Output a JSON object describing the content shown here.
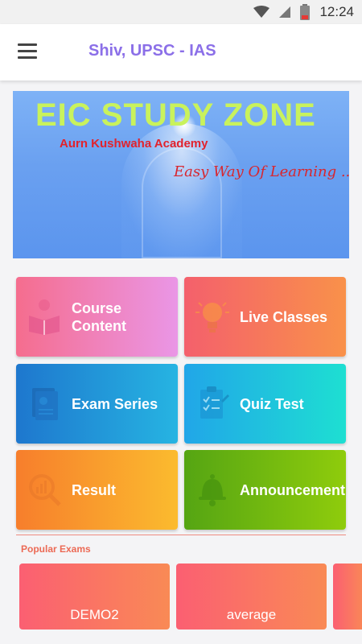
{
  "status_bar": {
    "time": "12:24"
  },
  "app_bar": {
    "title": "Shiv, UPSC - IAS",
    "title_color": "#8b6fe8"
  },
  "banner": {
    "title": "EIC STUDY ZONE",
    "subtitle": "Aurn Kushwaha Academy",
    "tagline": "Easy Way Of Learning ..."
  },
  "menu_tiles": [
    {
      "label": "Course Content",
      "icon": "reading-person-icon"
    },
    {
      "label": "Live Classes",
      "icon": "lightbulb-icon"
    },
    {
      "label": "Exam Series",
      "icon": "document-icon"
    },
    {
      "label": "Quiz Test",
      "icon": "clipboard-checklist-icon"
    },
    {
      "label": "Result",
      "icon": "chart-magnifier-icon"
    },
    {
      "label": "Announcement",
      "icon": "bell-icon"
    }
  ],
  "popular_exams": {
    "heading": "Popular Exams",
    "items": [
      {
        "label": "DEMO2"
      },
      {
        "label": "average"
      },
      {
        "label": ""
      }
    ]
  }
}
